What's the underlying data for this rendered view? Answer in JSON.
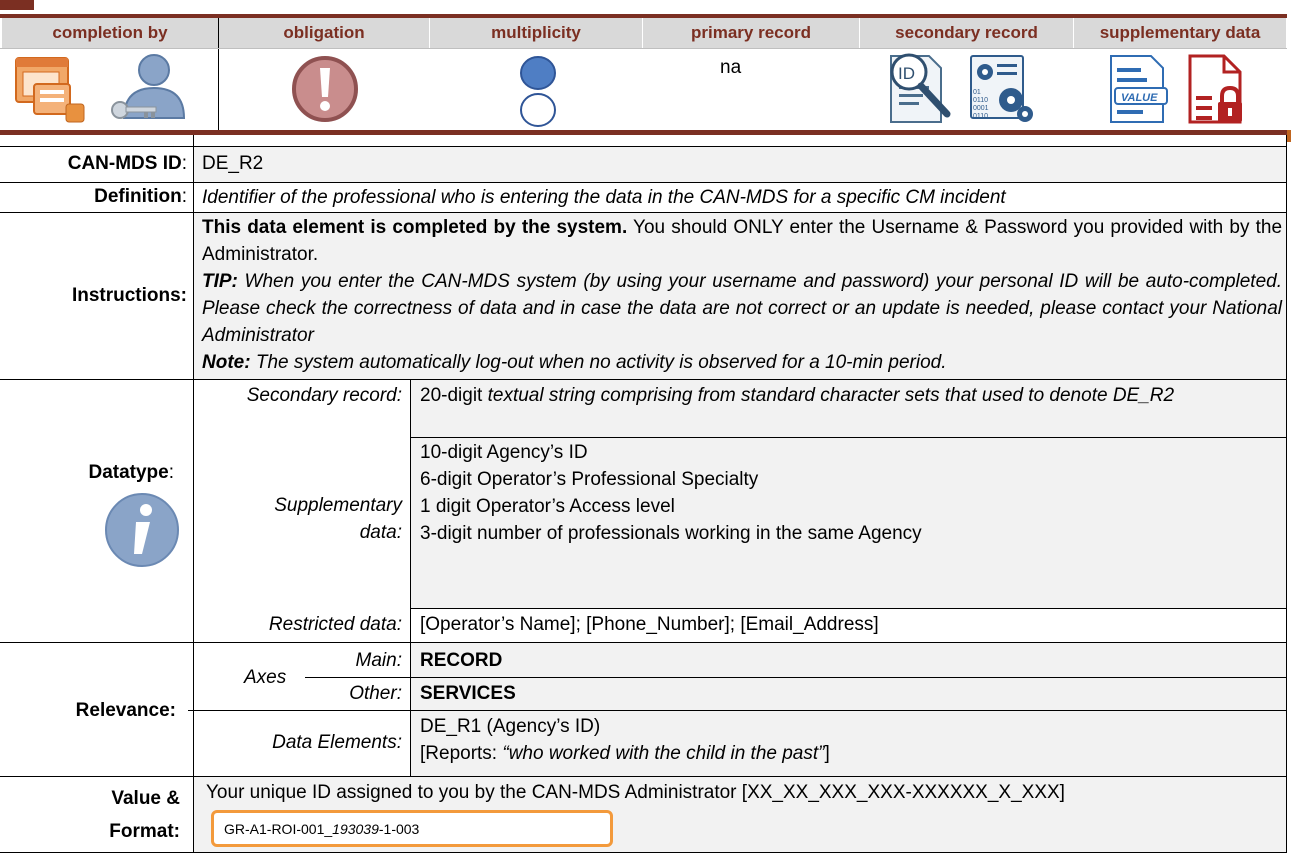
{
  "header": {
    "columns": [
      "completion by",
      "obligation",
      "multiplicity",
      "primary record",
      "secondary record",
      "supplementary data"
    ],
    "primary_record_value": "na",
    "icons": [
      "monitor-form-icon",
      "user-key-icon",
      "exclamation-icon",
      "filled-circle-icon",
      "empty-circle-icon",
      "id-magnifier-icon",
      "binary-gears-icon",
      "value-document-icon",
      "locked-document-icon"
    ],
    "icon_labels": {
      "id": "ID",
      "value": "VALUE",
      "binary": [
        "01",
        "0110",
        "0001",
        "0110"
      ]
    }
  },
  "colors": {
    "brand": "#7b2f22",
    "header_bg": "#d9d9d9",
    "row_bg": "#f2f2f2",
    "highlight_border": "#f39a3c"
  },
  "rows": {
    "id": {
      "label": "CAN-MDS ID",
      "colon": ":",
      "value": "DE_R2"
    },
    "definition": {
      "label": "Definition",
      "colon": ":",
      "value": "Identifier of the professional who is entering the data in the CAN-MDS for a specific CM incident"
    },
    "instructions": {
      "label": "Instructions:",
      "bold_lead": "This data element is completed by the system.",
      "text_1": " You should ONLY enter the Username & Password you provided with by the Administrator.",
      "tip_label": "TIP:",
      "tip_text": " When you enter the CAN-MDS system (by using your username and password) your personal ID will be auto-completed. Please check the correctness of data and in case the data are not correct or an update is needed, please contact your National Administrator",
      "note_label": "Note:",
      "note_text": " The system automatically log-out when no activity is observed for a 10-min period."
    },
    "datatype": {
      "label": "Datatype",
      "colon": ":",
      "secondary_label": "Secondary record:",
      "secondary_prefix": "20-digit ",
      "secondary_text": "textual string comprising from standard character sets that used to denote DE_R2",
      "supplementary_label_1": "Supplementary",
      "supplementary_label_2": "data:",
      "supplementary_items": [
        "10-digit Agency’s ID",
        "6-digit Operator’s Professional Specialty",
        "1 digit Operator’s Access level",
        "3-digit number of professionals working in the same Agency"
      ],
      "restricted_label": "Restricted data:",
      "restricted_value": "[Operator’s Name]; [Phone_Number]; [Email_Address]",
      "info_icon": "info-icon"
    },
    "relevance": {
      "label": "Relevance:",
      "axes_label": "Axes",
      "main_label": "Main:",
      "main_value": "RECORD",
      "other_label": "Other:",
      "other_value": "SERVICES",
      "elements_label": "Data Elements:",
      "elements_1": "DE_R1 (Agency’s ID)",
      "elements_2_prefix": "[Reports: ",
      "elements_2_italic": "“who worked with the child in the past”",
      "elements_2_suffix": "]"
    },
    "value_format": {
      "label_1": "Value &",
      "label_2": "Format:",
      "text": "Your unique ID assigned to you by the CAN-MDS Administrator [XX_XX_XXX_XXX-XXXXXX_X_XXX]",
      "example_prefix": "GR-A1-ROI-001_",
      "example_italic": "193039",
      "example_suffix": "-1-003"
    }
  }
}
